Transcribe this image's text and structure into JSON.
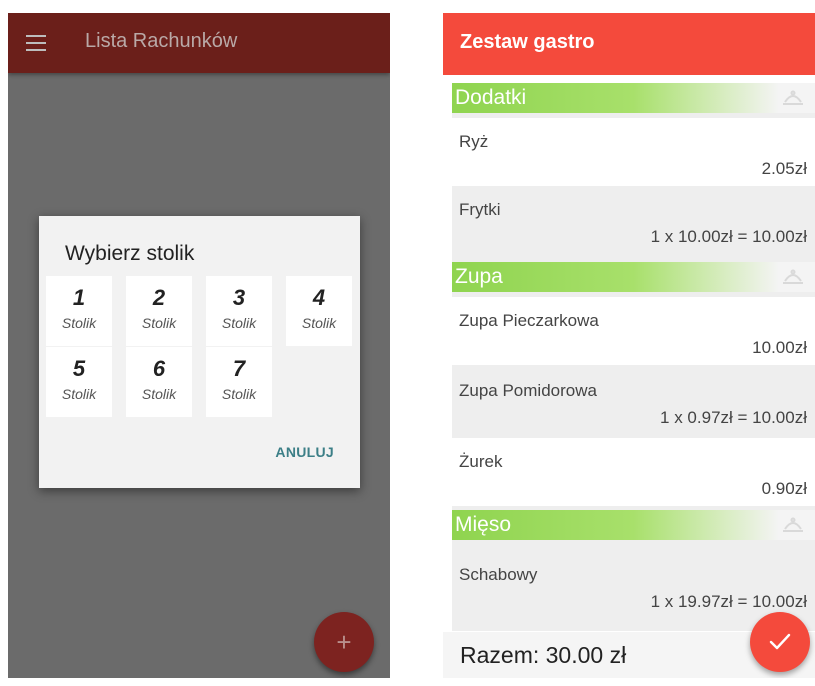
{
  "left_screen": {
    "app_title": "Lista Rachunków",
    "menu_icon": "hamburger-menu-icon",
    "dialog": {
      "title": "Wybierz stolik",
      "tables": [
        {
          "number": "1",
          "label": "Stolik"
        },
        {
          "number": "2",
          "label": "Stolik"
        },
        {
          "number": "3",
          "label": "Stolik"
        },
        {
          "number": "4",
          "label": "Stolik"
        },
        {
          "number": "5",
          "label": "Stolik"
        },
        {
          "number": "6",
          "label": "Stolik"
        },
        {
          "number": "7",
          "label": "Stolik"
        }
      ],
      "cancel_label": "ANULUJ"
    },
    "fab": {
      "label": "+",
      "icon": "add-icon"
    }
  },
  "right_screen": {
    "app_title": "Zestaw gastro",
    "categories": [
      {
        "name": "Dodatki",
        "icon": "dish-icon",
        "items": [
          {
            "name": "Ryż",
            "price": "2.05zł"
          },
          {
            "name": "Frytki",
            "price": "1 x 10.00zł = 10.00zł"
          }
        ]
      },
      {
        "name": "Zupa",
        "icon": "dish-icon",
        "items": [
          {
            "name": "Zupa Pieczarkowa",
            "price": "10.00zł"
          },
          {
            "name": "Zupa Pomidorowa",
            "price": "1 x 0.97zł = 10.00zł"
          },
          {
            "name": "Żurek",
            "price": "0.90zł"
          }
        ]
      },
      {
        "name": "Mięso",
        "icon": "dish-icon",
        "items": [
          {
            "name": "Schabowy",
            "price": "1 x 19.97zł = 10.00zł"
          }
        ]
      }
    ],
    "total_label": "Razem: 30.00 zł",
    "fab_icon": "check-icon",
    "colors": {
      "accent": "#f44a3c",
      "category_green": "#8fd44f",
      "dark_appbar": "#6b1f1a"
    }
  }
}
